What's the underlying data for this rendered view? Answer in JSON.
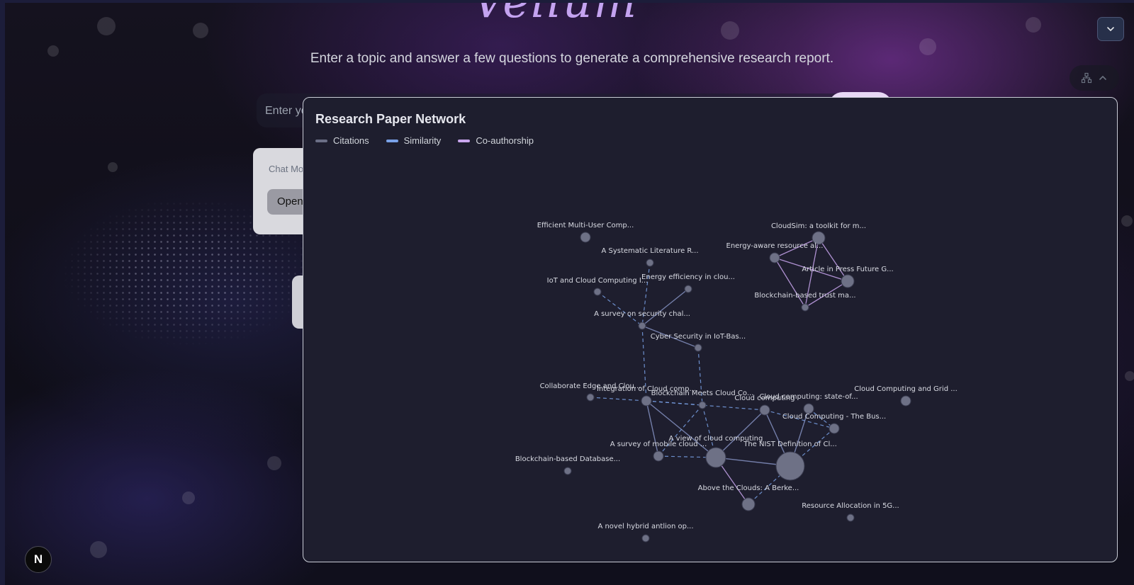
{
  "app": {
    "logo_text": "Vellum",
    "subtitle": "Enter a topic and answer a few questions to generate a comprehensive research report.",
    "topic_placeholder": "Enter yo",
    "chat_model_label": "Chat Mo",
    "chat_model_value": "Open",
    "badge": "N"
  },
  "colors": {
    "citations": "#6b6f86",
    "similarity": "#7aa2e8",
    "coauthorship": "#c9a6ee",
    "node": "#6e7186",
    "panel_bg": "#1e1e2e"
  },
  "panel": {
    "title": "Research Paper Network",
    "legend": [
      {
        "label": "Citations",
        "kind": "citations"
      },
      {
        "label": "Similarity",
        "kind": "similarity"
      },
      {
        "label": "Co-authorship",
        "kind": "coauthorship"
      }
    ]
  },
  "network": {
    "nodes": [
      {
        "id": "n1",
        "label": "Efficient Multi-User Comp...",
        "weight": 1
      },
      {
        "id": "n2",
        "label": "A Systematic Literature R...",
        "weight": 0
      },
      {
        "id": "n3",
        "label": "IoT and Cloud Computing I...",
        "weight": 0
      },
      {
        "id": "n4",
        "label": "Energy efficiency in clou...",
        "weight": 0
      },
      {
        "id": "n5",
        "label": "A survey on security chal...",
        "weight": 0
      },
      {
        "id": "n6",
        "label": "Cyber Security in IoT-Bas...",
        "weight": 0
      },
      {
        "id": "n7",
        "label": "CloudSim: a toolkit for m...",
        "weight": 2
      },
      {
        "id": "n8",
        "label": "Energy-aware resource al...",
        "weight": 1
      },
      {
        "id": "n9",
        "label": "Article in Press Future G...",
        "weight": 2
      },
      {
        "id": "n10",
        "label": "Blockchain-based trust ma...",
        "weight": 0
      },
      {
        "id": "n11",
        "label": "Collaborate Edge and Clou...",
        "weight": 0
      },
      {
        "id": "n12",
        "label": "Integration of Cloud comp...",
        "weight": 1
      },
      {
        "id": "n13",
        "label": "Blockchain Meets Cloud Co...",
        "weight": 0
      },
      {
        "id": "n14",
        "label": "Cloud computing",
        "weight": 1
      },
      {
        "id": "n15",
        "label": "Cloud computing: state-of...",
        "weight": 1
      },
      {
        "id": "n16",
        "label": "Cloud Computing and Grid ...",
        "weight": 1
      },
      {
        "id": "n17",
        "label": "Cloud Computing - The Bus...",
        "weight": 1
      },
      {
        "id": "n18",
        "label": "A survey of mobile cloud ...",
        "weight": 1
      },
      {
        "id": "n19",
        "label": "A view of cloud computing",
        "weight": 3
      },
      {
        "id": "n20",
        "label": "The NIST Definition of Cl...",
        "weight": 4
      },
      {
        "id": "n21",
        "label": "Blockchain-based Database...",
        "weight": 0
      },
      {
        "id": "n22",
        "label": "Above the Clouds: A Berke...",
        "weight": 2
      },
      {
        "id": "n23",
        "label": "Resource Allocation in 5G...",
        "weight": 0
      },
      {
        "id": "n24",
        "label": "A novel hybrid antlion op...",
        "weight": 0
      }
    ],
    "edges": [
      {
        "source": "n2",
        "target": "n5",
        "kind": "similarity"
      },
      {
        "source": "n3",
        "target": "n5",
        "kind": "similarity"
      },
      {
        "source": "n4",
        "target": "n5",
        "kind": "citations"
      },
      {
        "source": "n5",
        "target": "n6",
        "kind": "citations"
      },
      {
        "source": "n5",
        "target": "n12",
        "kind": "similarity"
      },
      {
        "source": "n6",
        "target": "n13",
        "kind": "similarity"
      },
      {
        "source": "n11",
        "target": "n12",
        "kind": "similarity"
      },
      {
        "source": "n12",
        "target": "n13",
        "kind": "similarity"
      },
      {
        "source": "n12",
        "target": "n14",
        "kind": "similarity"
      },
      {
        "source": "n12",
        "target": "n18",
        "kind": "citations"
      },
      {
        "source": "n12",
        "target": "n19",
        "kind": "citations"
      },
      {
        "source": "n13",
        "target": "n18",
        "kind": "similarity"
      },
      {
        "source": "n13",
        "target": "n19",
        "kind": "similarity"
      },
      {
        "source": "n14",
        "target": "n17",
        "kind": "similarity"
      },
      {
        "source": "n14",
        "target": "n19",
        "kind": "citations"
      },
      {
        "source": "n14",
        "target": "n20",
        "kind": "citations"
      },
      {
        "source": "n15",
        "target": "n20",
        "kind": "citations"
      },
      {
        "source": "n15",
        "target": "n17",
        "kind": "similarity"
      },
      {
        "source": "n17",
        "target": "n20",
        "kind": "similarity"
      },
      {
        "source": "n18",
        "target": "n19",
        "kind": "similarity"
      },
      {
        "source": "n19",
        "target": "n20",
        "kind": "citations"
      },
      {
        "source": "n19",
        "target": "n22",
        "kind": "coauthorship"
      },
      {
        "source": "n20",
        "target": "n22",
        "kind": "similarity"
      },
      {
        "source": "n7",
        "target": "n8",
        "kind": "coauthorship"
      },
      {
        "source": "n7",
        "target": "n9",
        "kind": "coauthorship"
      },
      {
        "source": "n7",
        "target": "n10",
        "kind": "coauthorship"
      },
      {
        "source": "n8",
        "target": "n9",
        "kind": "coauthorship"
      },
      {
        "source": "n8",
        "target": "n10",
        "kind": "coauthorship"
      },
      {
        "source": "n9",
        "target": "n10",
        "kind": "coauthorship"
      }
    ]
  }
}
